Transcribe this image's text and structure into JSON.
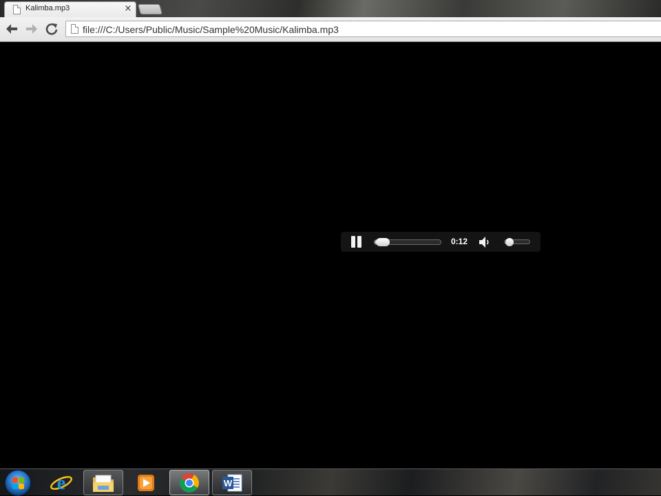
{
  "browser": {
    "tab": {
      "title": "Kalimba.mp3",
      "close_glyph": "×",
      "favicon": "page-icon"
    },
    "new_tab": {
      "icon": "new-tab-icon"
    },
    "toolbar": {
      "back_icon": "back-arrow-icon",
      "forward_icon": "forward-arrow-icon",
      "reload_icon": "reload-icon",
      "url": "file:///C:/Users/Public/Music/Sample%20Music/Kalimba.mp3"
    }
  },
  "player": {
    "state": "playing",
    "play_pause_icon": "pause-icon",
    "current_time": "0:12",
    "progress_fraction": 0.12,
    "volume_fraction": 0.2,
    "mute_icon": "speaker-icon"
  },
  "taskbar": {
    "start_icon": "windows-start-icon",
    "apps": [
      {
        "name": "Internet Explorer",
        "icon": "internet-explorer-icon",
        "state": "pinned"
      },
      {
        "name": "Windows Explorer",
        "icon": "folder-icon",
        "state": "open"
      },
      {
        "name": "Windows Media Player",
        "icon": "media-player-icon",
        "state": "pinned"
      },
      {
        "name": "Google Chrome",
        "icon": "chrome-icon",
        "state": "active"
      },
      {
        "name": "Microsoft Word",
        "icon": "word-icon",
        "state": "open"
      }
    ]
  },
  "colors": {
    "page_background": "#000000",
    "player_background": "#141414",
    "player_foreground": "#ffffff"
  }
}
